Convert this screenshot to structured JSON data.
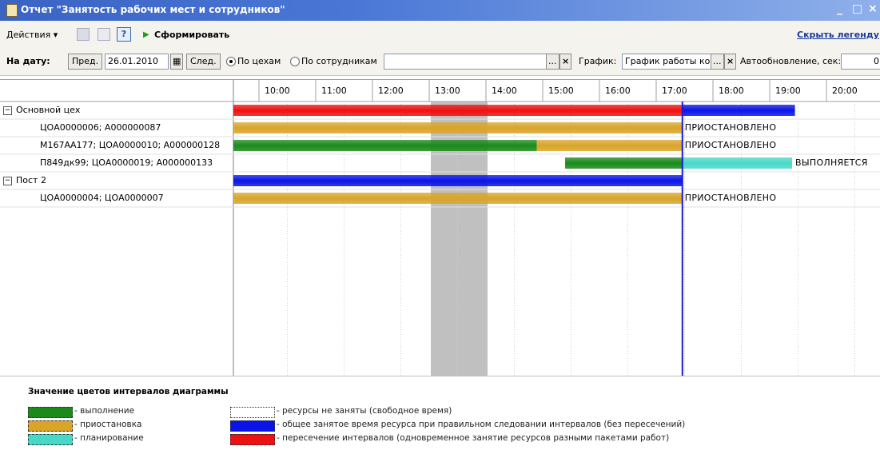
{
  "window": {
    "title": "Отчет  \"Занятость рабочих мест и сотрудников\"",
    "controls": [
      "_",
      "□",
      "×"
    ]
  },
  "toolbar": {
    "actions_label": "Действия",
    "generate_label": "Сформировать",
    "hide_legend_label": "Скрыть легенду"
  },
  "filters": {
    "date_label": "На дату:",
    "prev_label": "Пред.",
    "date_value": "26.01.2010",
    "next_label": "След.",
    "by_shops_label": "По цехам",
    "by_employees_label": "По сотрудникам",
    "schedule_label": "График:",
    "schedule_value": "График работы ко",
    "autoupdate_label": "Автообновление, сек:",
    "autoupdate_value": "0"
  },
  "gantt": {
    "times": [
      "10:00",
      "11:00",
      "12:00",
      "13:00",
      "14:00",
      "15:00",
      "16:00",
      "17:00",
      "18:00",
      "19:00",
      "20:00"
    ],
    "current_time": "17:26",
    "rows": [
      {
        "label": "Основной цех",
        "group": true,
        "bars": [
          {
            "type": "overlap",
            "start": "9:15",
            "end": "17:26"
          },
          {
            "type": "busy",
            "start": "17:26",
            "end": "19:25"
          }
        ],
        "status": ""
      },
      {
        "label": "ЦОА0000006; А000000087",
        "group": false,
        "bars": [
          {
            "type": "pause",
            "start": "9:15",
            "end": "17:26"
          }
        ],
        "status": "ПРИОСТАНОВЛЕНО"
      },
      {
        "label": "М167АА177; ЦОА0000010; А000000128",
        "group": false,
        "bars": [
          {
            "type": "execution",
            "start": "9:15",
            "end": "14:52"
          },
          {
            "type": "pause",
            "start": "14:52",
            "end": "17:26"
          }
        ],
        "status": "ПРИОСТАНОВЛЕНО"
      },
      {
        "label": "П849дк99; ЦОА0000019; А000000133",
        "group": false,
        "bars": [
          {
            "type": "execution",
            "start": "15:22",
            "end": "17:26"
          },
          {
            "type": "planning",
            "start": "17:26",
            "end": "19:22"
          }
        ],
        "status": "ВЫПОЛНЯЕТСЯ"
      },
      {
        "label": "Пост 2",
        "group": true,
        "bars": [
          {
            "type": "busy",
            "start": "9:15",
            "end": "17:26"
          }
        ],
        "status": ""
      },
      {
        "label": "ЦОА0000004; ЦОА0000007",
        "group": false,
        "bars": [
          {
            "type": "pause",
            "start": "9:15",
            "end": "17:26"
          }
        ],
        "status": "ПРИОСТАНОВЛЕНО"
      }
    ]
  },
  "legend": {
    "title": "Значение цветов интервалов диаграммы",
    "items": [
      {
        "label": "- выполнение",
        "color": "#1a8a1a"
      },
      {
        "label": "- приостановка",
        "color": "#d8a52a"
      },
      {
        "label": "- планирование",
        "color": "#48d8c8"
      },
      {
        "label": "- ресурсы не заняты (свободное время)",
        "color": "#ffffff"
      },
      {
        "label": "- общее занятое время ресурса при правильном следовании интервалов (без пересечений)",
        "color": "#0a14e8"
      },
      {
        "label": "- пересечение интервалов (одновременное занятие ресурсов разными пакетами работ)",
        "color": "#ee1111"
      }
    ]
  },
  "colors": {
    "execution": "#1a8a1a",
    "pause": "#d8a52a",
    "planning": "#48d8c8",
    "busy": "#0a14e8",
    "overlap": "#ee1111"
  }
}
